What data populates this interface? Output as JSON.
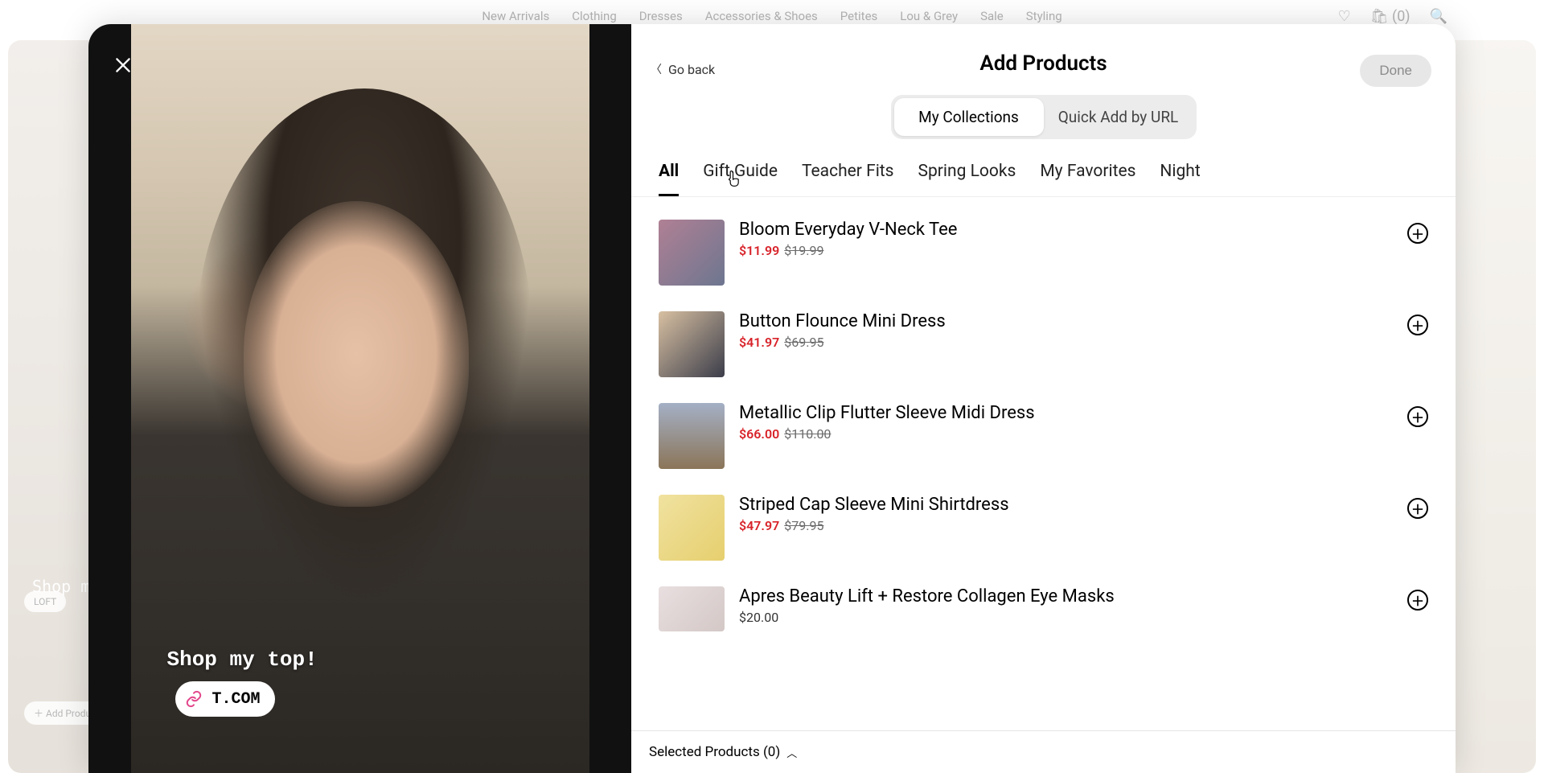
{
  "bg_nav": [
    "New Arrivals",
    "Clothing",
    "Dresses",
    "Accessories & Shoes",
    "Petites",
    "Lou & Grey",
    "Sale",
    "Styling"
  ],
  "bg_cart_count": "(0)",
  "bg_add_products_chip": "Add Products",
  "bg_shop_caption": "Shop m…",
  "bg_loft_chip": "LOFT",
  "modal": {
    "video_caption": "Shop my top!",
    "video_link_text": "T.COM",
    "go_back": "Go back",
    "title": "Add Products",
    "done": "Done",
    "segments": {
      "my_collections": "My Collections",
      "quick_add": "Quick Add by URL"
    },
    "tabs": [
      "All",
      "Gift Guide",
      "Teacher Fits",
      "Spring Looks",
      "My Favorites",
      "Night"
    ],
    "products": [
      {
        "name": "Bloom Everyday V-Neck Tee",
        "sale": "$11.99",
        "orig": "$19.99"
      },
      {
        "name": "Button Flounce Mini Dress",
        "sale": "$41.97",
        "orig": "$69.95"
      },
      {
        "name": "Metallic Clip Flutter Sleeve Midi Dress",
        "sale": "$66.00",
        "orig": "$110.00"
      },
      {
        "name": "Striped Cap Sleeve Mini Shirtdress",
        "sale": "$47.97",
        "orig": "$79.95"
      },
      {
        "name": "Apres Beauty Lift + Restore Collagen Eye Masks",
        "price": "$20.00"
      }
    ],
    "selected_bar": "Selected Products (0)"
  }
}
